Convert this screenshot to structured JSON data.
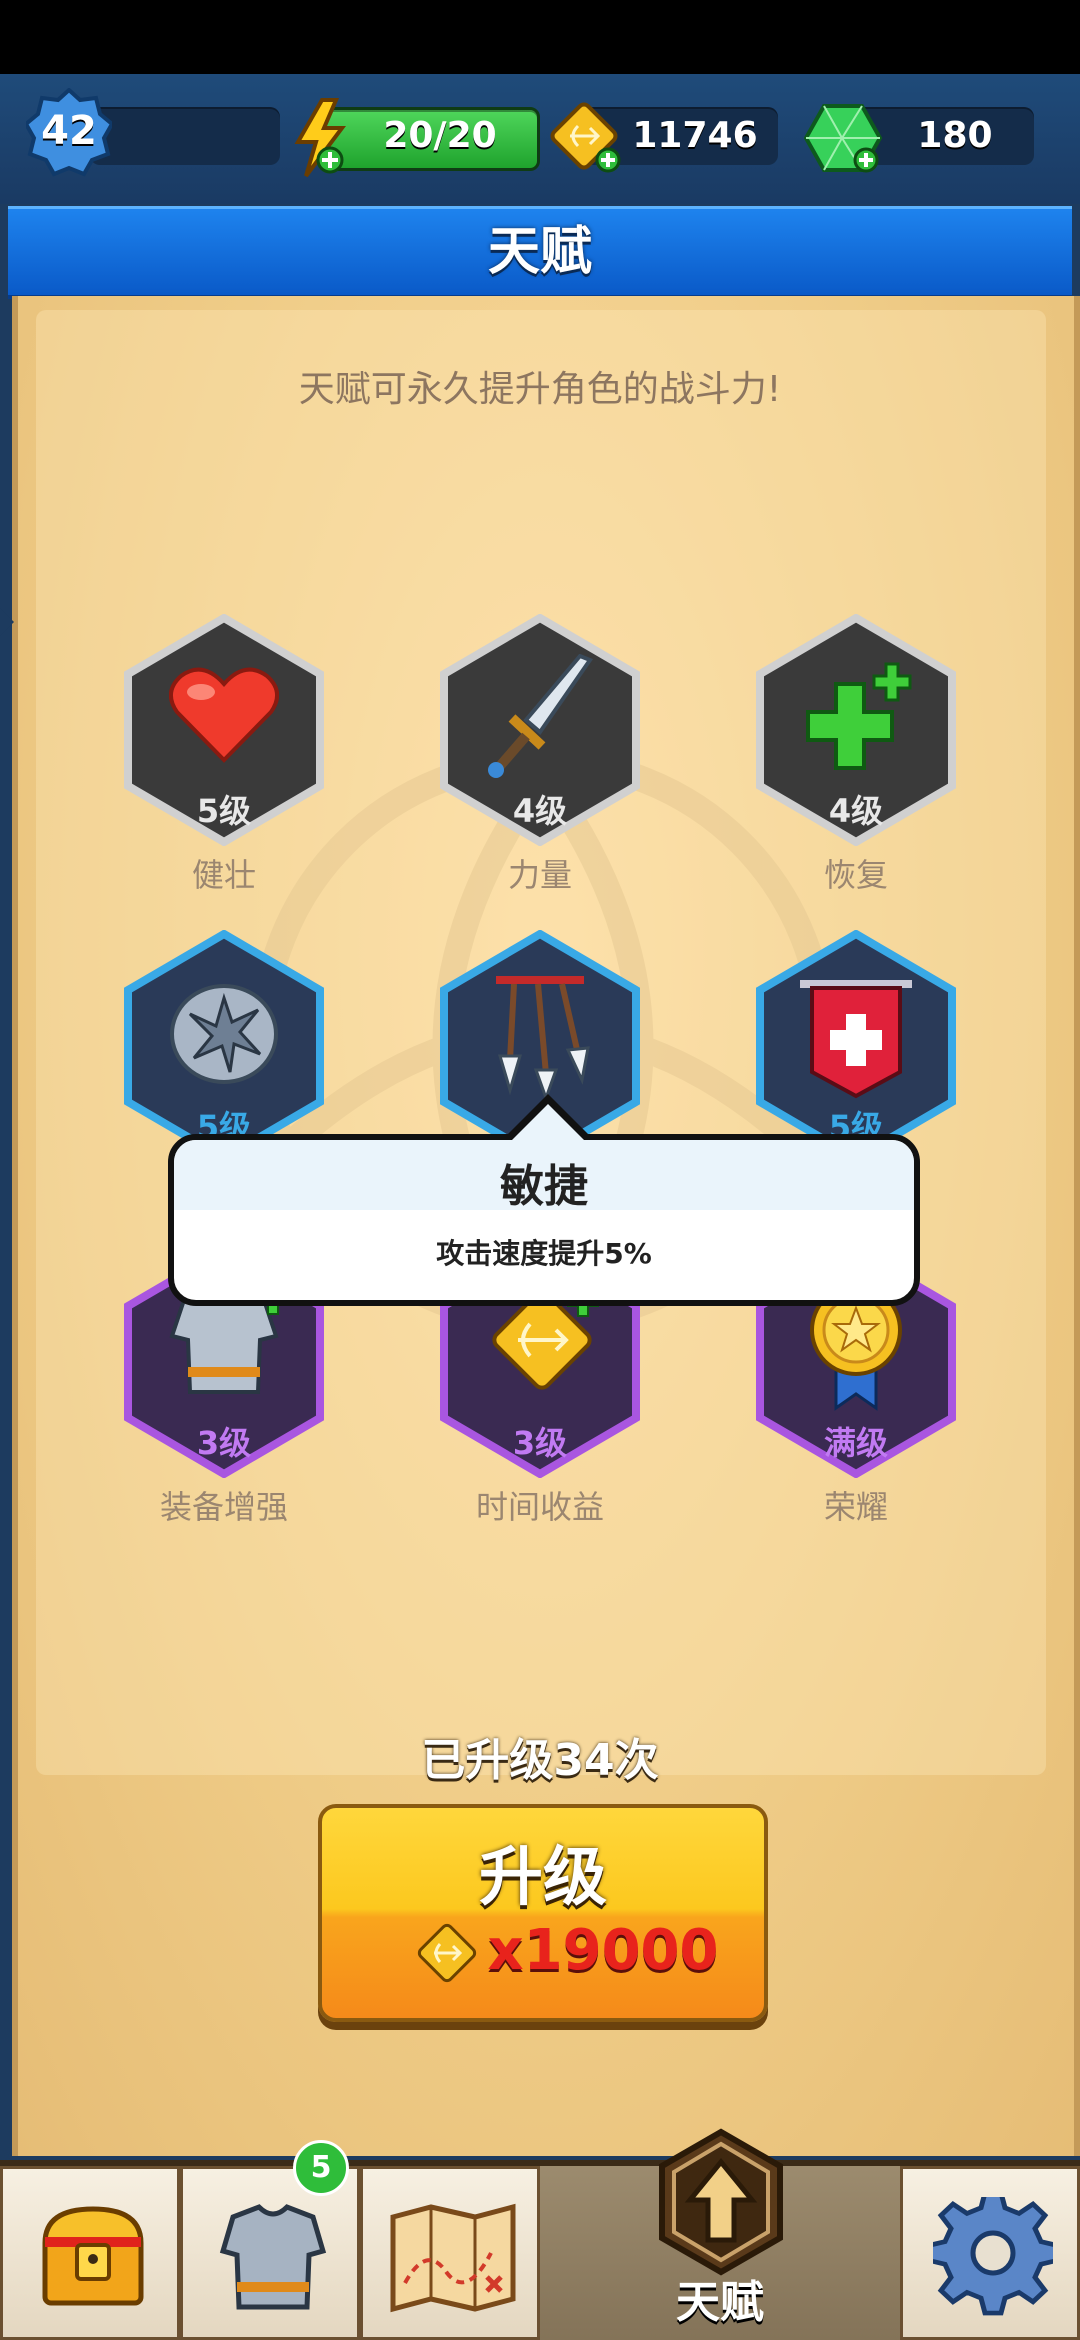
{
  "header": {
    "level": "42",
    "energy": "20/20",
    "gold": "11746",
    "gems": "180"
  },
  "page_title": "天赋",
  "subtitle": "天赋可永久提升角色的战斗力!",
  "talents": [
    {
      "name": "健壮",
      "level": "5级",
      "icon": "heart-icon"
    },
    {
      "name": "力量",
      "level": "4级",
      "icon": "sword-icon"
    },
    {
      "name": "恢复",
      "level": "4级",
      "icon": "heal-plus-icon"
    },
    {
      "name": "",
      "level": "5级",
      "icon": "spiked-shield-icon"
    },
    {
      "name": "",
      "level": "",
      "icon": "arrows-icon"
    },
    {
      "name": "",
      "level": "5级",
      "icon": "banner-icon"
    },
    {
      "name": "装备增强",
      "level": "3级",
      "icon": "armor-icon"
    },
    {
      "name": "时间收益",
      "level": "3级",
      "icon": "bow-coin-icon"
    },
    {
      "name": "荣耀",
      "level": "满级",
      "icon": "medal-icon"
    }
  ],
  "tooltip": {
    "title": "敏捷",
    "description": "攻击速度提升5%"
  },
  "upgrade": {
    "count_text": "已升级34次",
    "button_label": "升级",
    "cost": "x19000"
  },
  "nav": {
    "equipment_badge": "5",
    "active_label": "天赋"
  },
  "colors": {
    "tier1": "#c9c9c9",
    "tier2": "#39a9e6",
    "tier3": "#a956e0",
    "title_blue": "#1578e6",
    "button_yellow": "#fcc81e"
  }
}
